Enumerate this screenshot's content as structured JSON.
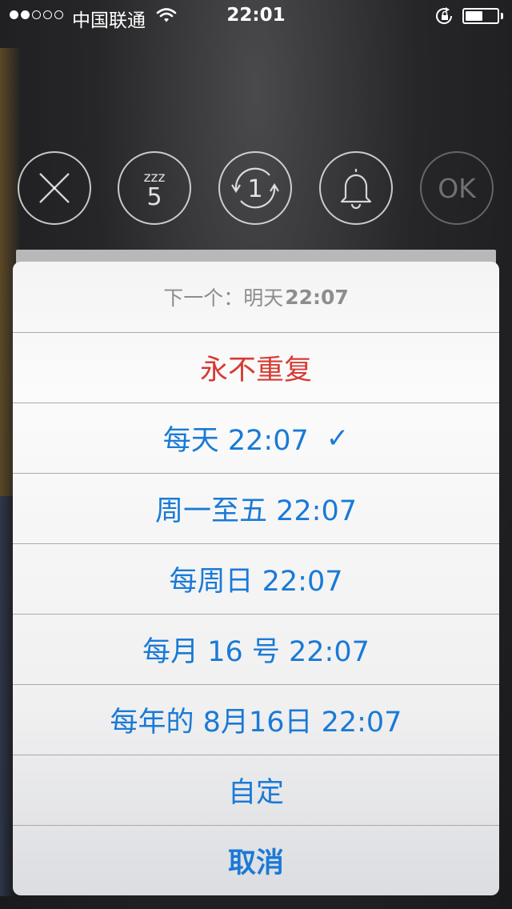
{
  "status_bar": {
    "carrier": "中国联通",
    "time": "22:01",
    "signal_bars_filled": 2,
    "signal_bars_total": 5,
    "battery_level": 0.55
  },
  "toolbar": {
    "snooze_minutes": "5",
    "snooze_glyph": "zzz",
    "repeat_count": "1",
    "ok_label": "OK"
  },
  "sheet": {
    "header_label": "下一个：明天",
    "header_time": "22:07",
    "options": [
      {
        "label": "永不重复",
        "checked": false,
        "color": "#d83a32"
      },
      {
        "label": "每天 22:07",
        "checked": true,
        "color": "#1a7ad6"
      },
      {
        "label": "周一至五 22:07",
        "checked": false,
        "color": "#1a7ad6"
      },
      {
        "label": "每周日 22:07",
        "checked": false,
        "color": "#1a7ad6"
      },
      {
        "label": "每月 16 号 22:07",
        "checked": false,
        "color": "#1a7ad6"
      },
      {
        "label": "每年的 8月16日 22:07",
        "checked": false,
        "color": "#1a7ad6"
      },
      {
        "label": "自定",
        "checked": false,
        "color": "#1a7ad6"
      }
    ],
    "checkmark": "✓",
    "cancel_label": "取消"
  }
}
